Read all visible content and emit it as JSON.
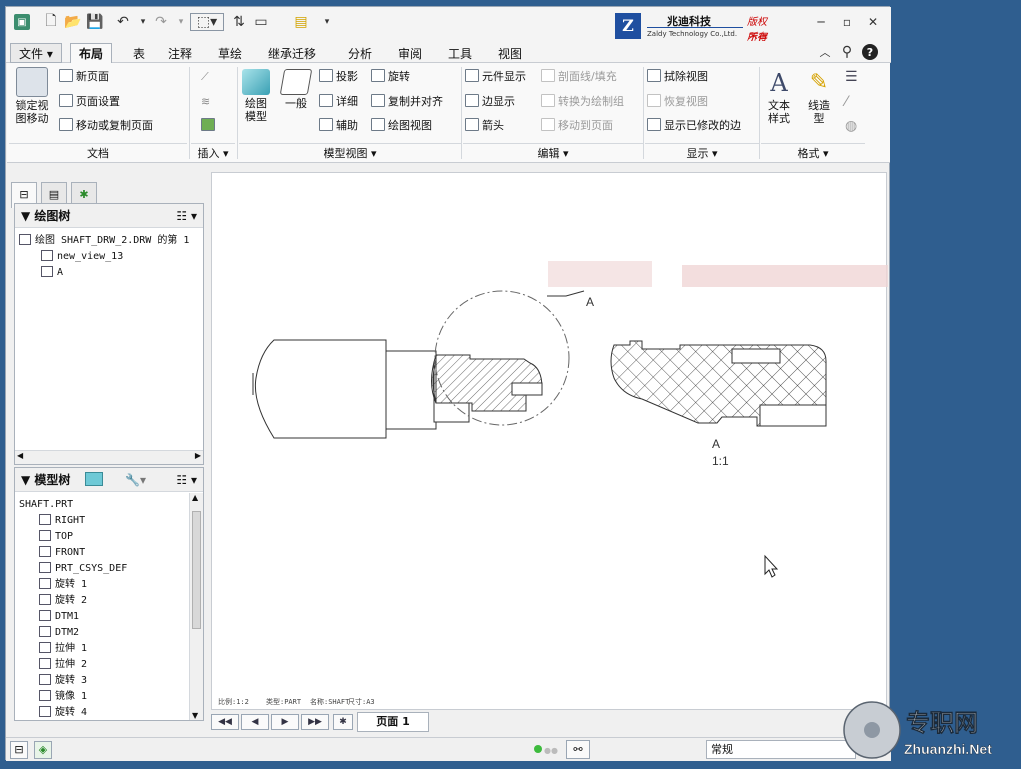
{
  "brand": {
    "logo_letter": "Z",
    "name_cn": "兆迪科技",
    "name_en": "Zaldy Technology Co.,Ltd.",
    "rights_1": "版权所有",
    "rights_2": "不得翻录"
  },
  "menu": {
    "file": "文件",
    "tabs": [
      "布局",
      "表",
      "注释",
      "草绘",
      "继承迁移",
      "分析",
      "审阅",
      "工具",
      "视图"
    ]
  },
  "ribbon": {
    "lock_view": "锁定视\n图移动",
    "new_page": "新页面",
    "page_setup": "页面设置",
    "move_copy_page": "移动或复制页面",
    "drawing_model": "绘图\n模型",
    "general": "一般",
    "projection": "投影",
    "detailed": "详细",
    "auxiliary": "辅助",
    "revolve": "旋转",
    "copy_align": "复制并对齐",
    "drawing_view": "绘图视图",
    "element_display": "元件显示",
    "edge_display": "边显示",
    "arrow": "箭头",
    "section_line": "剖面线/填充",
    "convert_group": "转换为绘制组",
    "move_to_page": "移动到页面",
    "erase_view": "拭除视图",
    "restore_view": "恢复视图",
    "show_modified_edges": "显示已修改的边",
    "text_style": "文本\n样式",
    "line_style": "线造\n型",
    "groups": {
      "doc": "文档",
      "insert": "插入",
      "model_views": "模型视图",
      "edit": "编辑",
      "display": "显示",
      "format": "格式"
    }
  },
  "drawing_tree": {
    "title": "绘图树",
    "items": [
      "绘图 SHAFT_DRW_2.DRW 的第 1",
      "new_view_13",
      "A"
    ]
  },
  "model_tree": {
    "title": "模型树",
    "items": [
      "SHAFT.PRT",
      "RIGHT",
      "TOP",
      "FRONT",
      "PRT_CSYS_DEF",
      "旋转 1",
      "旋转 2",
      "DTM1",
      "DTM2",
      "拉伸 1",
      "拉伸 2",
      "旋转 3",
      "镜像 1",
      "旋转 4"
    ]
  },
  "canvas": {
    "detail_label_a": "A",
    "view_label_a": "A",
    "scale_label": "1:1",
    "bottom_info": [
      "比例:1:2",
      "类型:PART",
      "名称:SHAFT",
      "尺寸:A3"
    ]
  },
  "page_tab": "页面 1",
  "status": {
    "filter": "常规"
  },
  "watermark": {
    "title": "专职网",
    "url": "Zhuanzhi.Net"
  }
}
